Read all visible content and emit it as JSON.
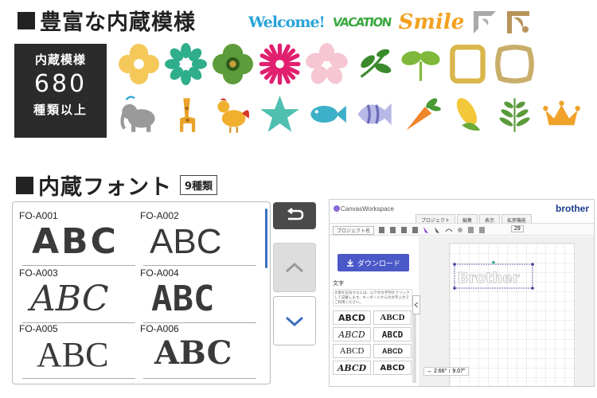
{
  "section_patterns": {
    "title": "豊富な内蔵模様"
  },
  "logos": {
    "welcome": "Welcome!",
    "vacation": "VACATION",
    "smile": "Smile"
  },
  "count_box": {
    "line1": "内蔵模様",
    "number": "680",
    "line3": "種類以上"
  },
  "section_fonts": {
    "title": "内蔵フォント",
    "badge": "9種類"
  },
  "font_panel": {
    "cells": [
      {
        "code": "FO-A001",
        "sample": "ABC"
      },
      {
        "code": "FO-A002",
        "sample": "ABC"
      },
      {
        "code": "FO-A003",
        "sample": "ABC"
      },
      {
        "code": "FO-A004",
        "sample": "ABC"
      },
      {
        "code": "FO-A005",
        "sample": "ABC"
      },
      {
        "code": "FO-A006",
        "sample": "ABC"
      }
    ]
  },
  "canvas_workspace": {
    "app_name": "CanvasWorkspace",
    "brand": "brother",
    "tabs": [
      "プロジェクト",
      "編集",
      "表示",
      "拡張機能"
    ],
    "project_label": "プロジェクト名",
    "zoom": "29",
    "download_label": "ダウンロード",
    "text_label": "文字",
    "description": "文章を記号するには、以下の文字列をクリックして記載します。キーボードからの文字入力でご利用ください。",
    "font_items": [
      "ABCD",
      "ABCD",
      "ABCD",
      "ABCD",
      "ABCD",
      "ABCD",
      "ABCD",
      "ABCD"
    ],
    "mat_text": "Brother",
    "coords": "↔ 2.66″ ↕ 9.07″"
  }
}
